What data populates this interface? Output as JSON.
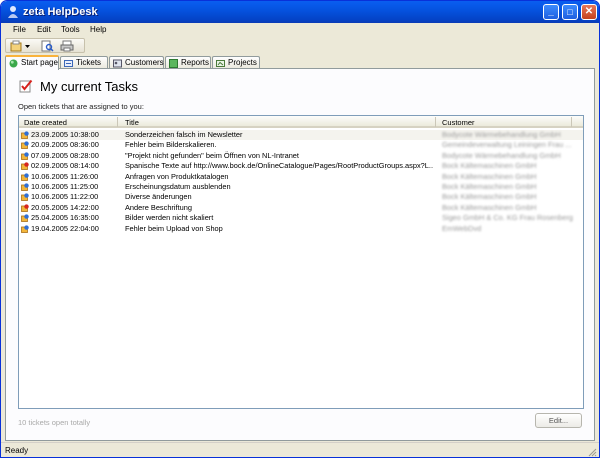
{
  "window": {
    "title": "zeta HelpDesk",
    "controls": {
      "minimize": "_",
      "maximize": "□",
      "close": "✕"
    },
    "accent": "#0553e0"
  },
  "menu": [
    "File",
    "Edit",
    "Tools",
    "Help"
  ],
  "toolbar": {
    "icons": [
      "new-ticket-icon",
      "dropdown-arrow-icon",
      "search-icon",
      "print-icon"
    ]
  },
  "tabs": [
    {
      "label": "Start page",
      "icon": "home-icon",
      "active": true
    },
    {
      "label": "Tickets",
      "icon": "tickets-icon",
      "active": false
    },
    {
      "label": "Customers",
      "icon": "customers-icon",
      "active": false
    },
    {
      "label": "Reports",
      "icon": "reports-icon",
      "active": false
    },
    {
      "label": "Projects",
      "icon": "projects-icon",
      "active": false
    }
  ],
  "main": {
    "heading": "My current Tasks",
    "subheading": "Open tickets that are assigned to you:",
    "columns": [
      "Date created",
      "Title",
      "Customer"
    ],
    "rows": [
      {
        "date": "23.09.2005 10:38:00",
        "title": "Sonderzeichen falsch im Newsletter",
        "customer": "Bodycote Wärmebehandlung GmbH",
        "status": "new",
        "selected": true
      },
      {
        "date": "20.09.2005 08:36:00",
        "title": "Fehler beim Bilderskalieren.",
        "customer": "Gemeindeverwaltung Leiningen Frau ...",
        "status": "new",
        "selected": false
      },
      {
        "date": "07.09.2005 08:28:00",
        "title": "\"Projekt nicht gefunden\" beim Öffnen von NL-Intranet",
        "customer": "Bodycote Wärmebehandlung GmbH",
        "status": "new",
        "selected": false
      },
      {
        "date": "02.09.2005 08:14:00",
        "title": "Spanische Texte auf http://www.bock.de/OnlineCatalogue/Pages/RootProductGroups.aspx?L...",
        "customer": "Bock Kältemaschinen GmbH",
        "status": "urgent",
        "selected": false
      },
      {
        "date": "10.06.2005 11:26:00",
        "title": "Anfragen von Produktkatalogen",
        "customer": "Bock Kältemaschinen GmbH",
        "status": "new",
        "selected": false
      },
      {
        "date": "10.06.2005 11:25:00",
        "title": "Erscheinungsdatum ausblenden",
        "customer": "Bock Kältemaschinen GmbH",
        "status": "new",
        "selected": false
      },
      {
        "date": "10.06.2005 11:22:00",
        "title": "Diverse änderungen",
        "customer": "Bock Kältemaschinen GmbH",
        "status": "new",
        "selected": false
      },
      {
        "date": "20.05.2005 14:22:00",
        "title": "Andere Beschriftung",
        "customer": "Bock Kältemaschinen GmbH",
        "status": "urgent",
        "selected": false
      },
      {
        "date": "25.04.2005 16:35:00",
        "title": "Bilder werden nicht skaliert",
        "customer": "Sigeo GmbH & Co. KG Frau Rosenberg",
        "status": "new",
        "selected": false
      },
      {
        "date": "19.04.2005 22:04:00",
        "title": "Fehler beim Upload von Shop",
        "customer": "EmWebDvd",
        "status": "new",
        "selected": false
      }
    ],
    "footer": "10 tickets open totally",
    "edit_label": "Edit..."
  },
  "status": {
    "text": "Ready"
  }
}
